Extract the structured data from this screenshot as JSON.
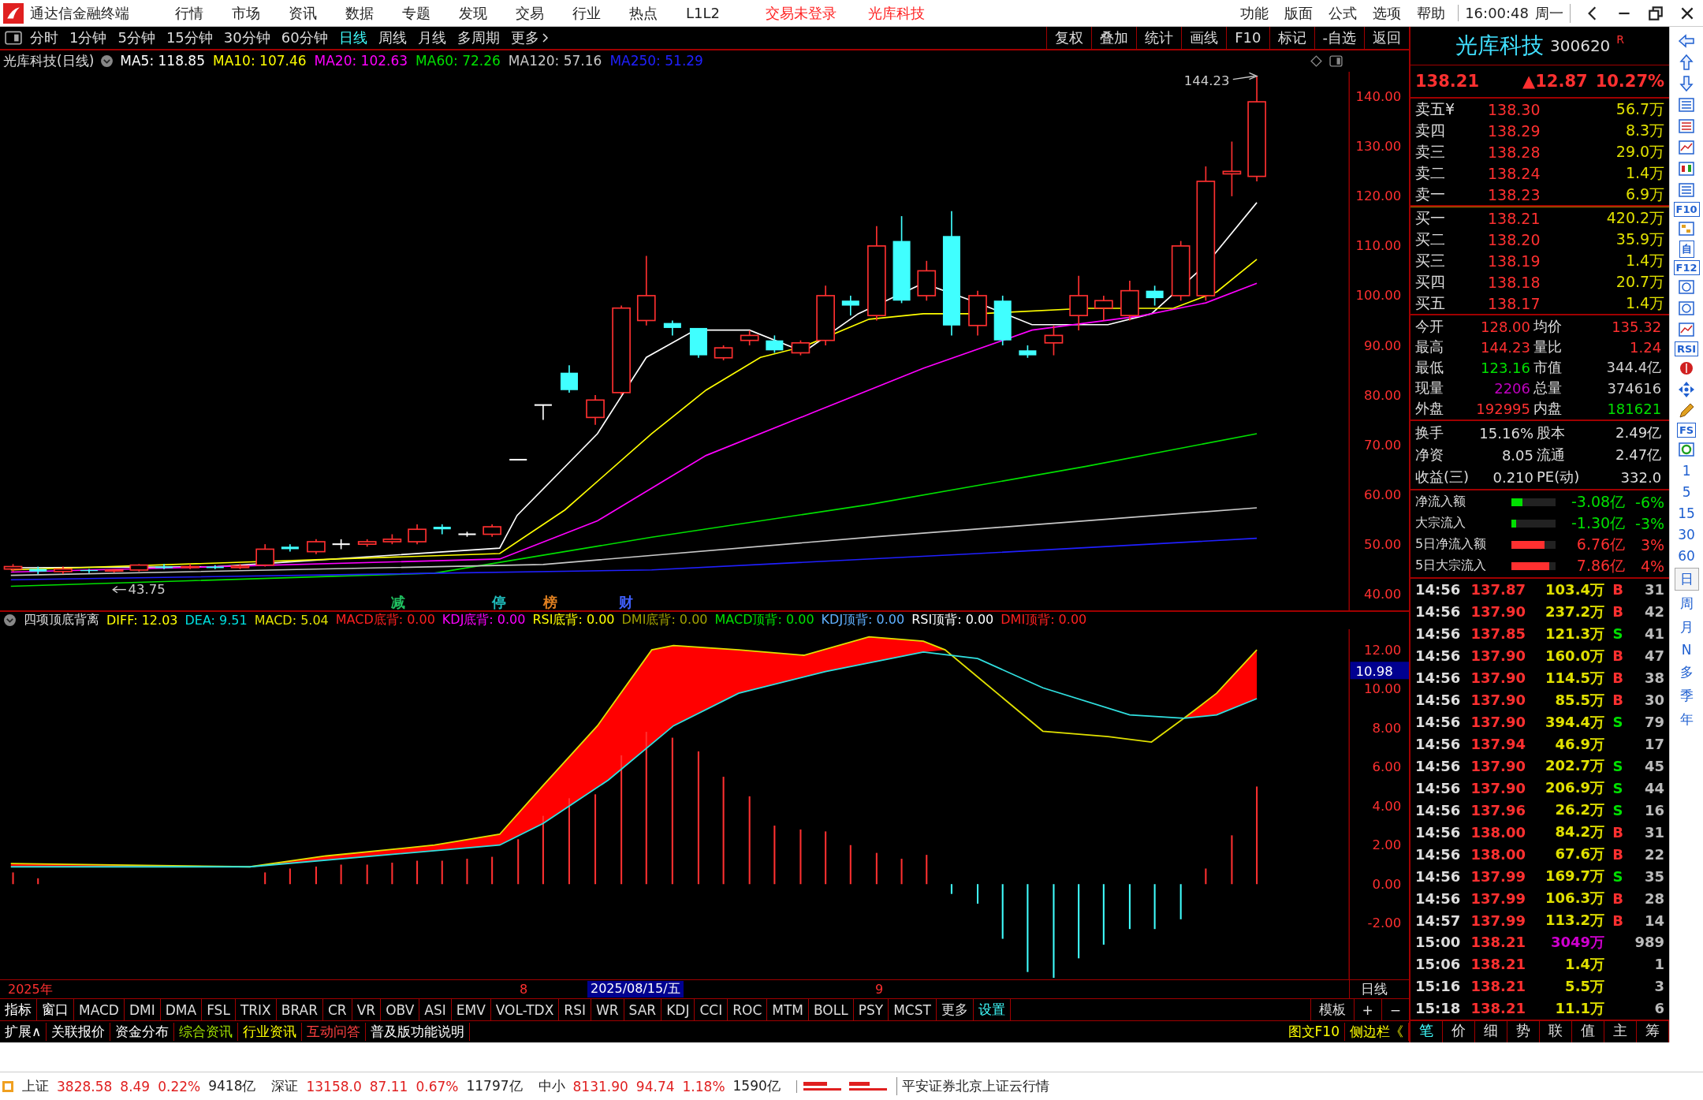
{
  "window": {
    "app_name": "通达信金融终端",
    "menu": [
      "行情",
      "市场",
      "资讯",
      "数据",
      "专题",
      "发现",
      "交易",
      "行业",
      "热点",
      "L1L2"
    ],
    "login_status": "交易未登录",
    "stock_name": "光库科技",
    "right_menu": [
      "功能",
      "版面",
      "公式",
      "选项",
      "帮助"
    ],
    "clock": "16:00:48",
    "weekday": "周一"
  },
  "period_tabs": [
    {
      "label": "分时",
      "selected": false
    },
    {
      "label": "1分钟",
      "selected": false
    },
    {
      "label": "5分钟",
      "selected": false
    },
    {
      "label": "15分钟",
      "selected": false
    },
    {
      "label": "30分钟",
      "selected": false
    },
    {
      "label": "60分钟",
      "selected": false
    },
    {
      "label": "日线",
      "selected": true
    },
    {
      "label": "周线",
      "selected": false
    },
    {
      "label": "月线",
      "selected": false
    },
    {
      "label": "多周期",
      "selected": false
    },
    {
      "label": "更多",
      "selected": false
    }
  ],
  "chart_tools": [
    "复权",
    "叠加",
    "统计",
    "画线",
    "F10",
    "标记",
    "-自选",
    "返回"
  ],
  "main_chart": {
    "title": "光库科技(日线)",
    "ma": [
      {
        "label": "MA5: 118.85",
        "color": "#ffffff"
      },
      {
        "label": "MA10: 107.46",
        "color": "#ffff00"
      },
      {
        "label": "MA20: 102.63",
        "color": "#ff00ff"
      },
      {
        "label": "MA60: 72.26",
        "color": "#00e000"
      },
      {
        "label": "MA120: 57.16",
        "color": "#c8c8c8"
      },
      {
        "label": "MA250: 51.29",
        "color": "#2020ff"
      }
    ],
    "price_labels": [
      "140.00",
      "130.00",
      "120.00",
      "110.00",
      "100.00",
      "90.00",
      "80.00",
      "70.00",
      "60.00",
      "50.00",
      "40.00"
    ],
    "high_label": "144.23",
    "low_label": "43.75",
    "events": [
      {
        "label": "减",
        "color": "#20c060"
      },
      {
        "label": "停",
        "color": "#20c0c0"
      },
      {
        "label": "榜",
        "color": "#e08020"
      },
      {
        "label": "财",
        "color": "#4060ff"
      }
    ]
  },
  "indicator": {
    "name": "四项顶底背离",
    "values": [
      {
        "label": "DIFF: 12.03",
        "color": "#ffff00"
      },
      {
        "label": "DEA: 9.51",
        "color": "#00e0e0"
      },
      {
        "label": "MACD: 5.04",
        "color": "#e0e000"
      },
      {
        "label": "MACD底背: 0.00",
        "color": "#ff2020"
      },
      {
        "label": "KDJ底背: 0.00",
        "color": "#ff00ff"
      },
      {
        "label": "RSI底背: 0.00",
        "color": "#ffff00"
      },
      {
        "label": "DMI底背: 0.00",
        "color": "#a0a000"
      },
      {
        "label": "MACD顶背: 0.00",
        "color": "#00e000"
      },
      {
        "label": "KDJ顶背: 0.00",
        "color": "#60b0ff"
      },
      {
        "label": "RSI顶背: 0.00",
        "color": "#ffffff"
      },
      {
        "label": "DMI顶背: 0.00",
        "color": "#ff2020"
      }
    ],
    "axis_labels": [
      "12.00",
      "10.00",
      "8.00",
      "6.00",
      "4.00",
      "2.00",
      "0.00",
      "-2.00"
    ],
    "current": "10.98"
  },
  "date_axis": {
    "year": "2025年",
    "month_8": "8",
    "selected_date": "2025/08/15/五",
    "month_9": "9",
    "period": "日线"
  },
  "indicator_tabs": [
    {
      "label": "指标",
      "kind": "menu"
    },
    {
      "label": "窗口",
      "kind": "menu"
    },
    {
      "label": "MACD",
      "kind": "tab"
    },
    {
      "label": "DMI",
      "kind": "tab"
    },
    {
      "label": "DMA",
      "kind": "tab"
    },
    {
      "label": "FSL",
      "kind": "tab"
    },
    {
      "label": "TRIX",
      "kind": "tab"
    },
    {
      "label": "BRAR",
      "kind": "tab"
    },
    {
      "label": "CR",
      "kind": "tab"
    },
    {
      "label": "VR",
      "kind": "tab"
    },
    {
      "label": "OBV",
      "kind": "tab"
    },
    {
      "label": "ASI",
      "kind": "tab"
    },
    {
      "label": "EMV",
      "kind": "tab"
    },
    {
      "label": "VOL-TDX",
      "kind": "tab"
    },
    {
      "label": "RSI",
      "kind": "tab"
    },
    {
      "label": "WR",
      "kind": "tab"
    },
    {
      "label": "SAR",
      "kind": "tab"
    },
    {
      "label": "KDJ",
      "kind": "tab"
    },
    {
      "label": "CCI",
      "kind": "tab"
    },
    {
      "label": "ROC",
      "kind": "tab"
    },
    {
      "label": "MTM",
      "kind": "tab"
    },
    {
      "label": "BOLL",
      "kind": "tab"
    },
    {
      "label": "PSY",
      "kind": "tab"
    },
    {
      "label": "MCST",
      "kind": "tab"
    },
    {
      "label": "更多",
      "kind": "tab"
    },
    {
      "label": "设置",
      "kind": "settings"
    }
  ],
  "indicator_tools": [
    "模板",
    "+",
    "−"
  ],
  "ext_tabs": [
    {
      "label": "扩展∧",
      "color": "#ffffff"
    },
    {
      "label": "关联报价",
      "color": "#ffffff"
    },
    {
      "label": "资金分布",
      "color": "#ffffff"
    },
    {
      "label": "综合资讯",
      "color": "#a0e000"
    },
    {
      "label": "行业资讯",
      "color": "#ffff00"
    },
    {
      "label": "互动问答",
      "color": "#ff4040"
    },
    {
      "label": "普及版功能说明",
      "color": "#ffffff"
    }
  ],
  "ext_right": [
    "图文F10",
    "侧边栏《"
  ],
  "quote": {
    "name": "光库科技",
    "code": "300620",
    "mark": "R",
    "price": "138.21",
    "change": "▲12.87",
    "pct": "10.27%"
  },
  "asks": [
    {
      "label": "卖五¥",
      "price": "138.30",
      "volume": "56.7万"
    },
    {
      "label": "卖四",
      "price": "138.29",
      "volume": "8.3万"
    },
    {
      "label": "卖三",
      "price": "138.28",
      "volume": "29.0万"
    },
    {
      "label": "卖二",
      "price": "138.24",
      "volume": "1.4万"
    },
    {
      "label": "卖一",
      "price": "138.23",
      "volume": "6.9万"
    }
  ],
  "bids": [
    {
      "label": "买一",
      "price": "138.21",
      "volume": "420.2万"
    },
    {
      "label": "买二",
      "price": "138.20",
      "volume": "35.9万"
    },
    {
      "label": "买三",
      "price": "138.19",
      "volume": "1.4万"
    },
    {
      "label": "买四",
      "price": "138.18",
      "volume": "20.7万"
    },
    {
      "label": "买五",
      "price": "138.17",
      "volume": "1.4万"
    }
  ],
  "stats": [
    {
      "label": "今开",
      "value": "128.00",
      "color": "#ff3030"
    },
    {
      "label": "均价",
      "value": "135.32",
      "color": "#ff3030"
    },
    {
      "label": "最高",
      "value": "144.23",
      "color": "#ff3030"
    },
    {
      "label": "量比",
      "value": "1.24",
      "color": "#ff3030"
    },
    {
      "label": "最低",
      "value": "123.16",
      "color": "#00e000"
    },
    {
      "label": "市值",
      "value": "344.4亿",
      "color": "#d0d0d0"
    },
    {
      "label": "现量",
      "value": "2206",
      "color": "#c000c0"
    },
    {
      "label": "总量",
      "value": "374616",
      "color": "#d0d0d0"
    },
    {
      "label": "外盘",
      "value": "192995",
      "color": "#ff3030"
    },
    {
      "label": "内盘",
      "value": "181621",
      "color": "#00e000"
    }
  ],
  "stats2": [
    {
      "label": "换手",
      "value": "15.16%"
    },
    {
      "label": "股本",
      "value": "2.49亿"
    },
    {
      "label": "净资",
      "value": "8.05"
    },
    {
      "label": "流通",
      "value": "2.47亿"
    },
    {
      "label": "收益(三)",
      "value": "0.210"
    },
    {
      "label": "PE(动)",
      "value": "332.0"
    }
  ],
  "flows": [
    {
      "label": "净流入额",
      "value": "-3.08亿",
      "pct": "-6%",
      "color": "#00e000",
      "level": 0.25
    },
    {
      "label": "大宗流入",
      "value": "-1.30亿",
      "pct": "-3%",
      "color": "#00e000",
      "level": 0.1
    },
    {
      "label": "5日净流入额",
      "value": "6.76亿",
      "pct": "3%",
      "color": "#ff3030",
      "level": 0.75
    },
    {
      "label": "5日大宗流入",
      "value": "7.86亿",
      "pct": "4%",
      "color": "#ff3030",
      "level": 0.85
    }
  ],
  "trades": [
    {
      "time": "14:56",
      "price": "137.87",
      "volume": "103.4万",
      "side": "B",
      "count": "31",
      "large": false
    },
    {
      "time": "14:56",
      "price": "137.90",
      "volume": "237.2万",
      "side": "B",
      "count": "42",
      "large": false
    },
    {
      "time": "14:56",
      "price": "137.85",
      "volume": "121.3万",
      "side": "S",
      "count": "41",
      "large": false
    },
    {
      "time": "14:56",
      "price": "137.90",
      "volume": "160.0万",
      "side": "B",
      "count": "47",
      "large": false
    },
    {
      "time": "14:56",
      "price": "137.90",
      "volume": "114.5万",
      "side": "B",
      "count": "38",
      "large": false
    },
    {
      "time": "14:56",
      "price": "137.90",
      "volume": "85.5万",
      "side": "B",
      "count": "30",
      "large": false
    },
    {
      "time": "14:56",
      "price": "137.90",
      "volume": "394.4万",
      "side": "S",
      "count": "79",
      "large": false
    },
    {
      "time": "14:56",
      "price": "137.94",
      "volume": "46.9万",
      "count": "17",
      "large": false
    },
    {
      "time": "14:56",
      "price": "137.90",
      "volume": "202.7万",
      "side": "S",
      "count": "45",
      "large": false
    },
    {
      "time": "14:56",
      "price": "137.90",
      "volume": "206.9万",
      "side": "S",
      "count": "44",
      "large": false
    },
    {
      "time": "14:56",
      "price": "137.96",
      "volume": "26.2万",
      "side": "S",
      "count": "16",
      "large": false
    },
    {
      "time": "14:56",
      "price": "138.00",
      "volume": "84.2万",
      "side": "B",
      "count": "31",
      "large": false
    },
    {
      "time": "14:56",
      "price": "138.00",
      "volume": "67.6万",
      "side": "B",
      "count": "22",
      "large": false
    },
    {
      "time": "14:56",
      "price": "137.99",
      "volume": "169.7万",
      "side": "S",
      "count": "35",
      "large": false
    },
    {
      "time": "14:56",
      "price": "137.99",
      "volume": "106.3万",
      "side": "B",
      "count": "28",
      "large": false
    },
    {
      "time": "14:57",
      "price": "137.99",
      "volume": "113.2万",
      "side": "B",
      "count": "14",
      "large": false
    },
    {
      "time": "15:00",
      "price": "138.21",
      "volume": "3049万",
      "count": "989",
      "large": true
    },
    {
      "time": "15:06",
      "price": "138.21",
      "volume": "1.4万",
      "count": "1",
      "large": false
    },
    {
      "time": "15:16",
      "price": "138.21",
      "volume": "5.5万",
      "count": "3",
      "large": false
    },
    {
      "time": "15:18",
      "price": "138.21",
      "volume": "11.1万",
      "count": "6",
      "large": false
    }
  ],
  "detail_tabs": [
    {
      "label": "笔",
      "selected": true
    },
    {
      "label": "价",
      "selected": false
    },
    {
      "label": "细",
      "selected": false
    },
    {
      "label": "势",
      "selected": false
    },
    {
      "label": "联",
      "selected": false
    },
    {
      "label": "值",
      "selected": false
    },
    {
      "label": "主",
      "selected": false
    },
    {
      "label": "筹",
      "selected": false
    }
  ],
  "sidebar": {
    "labels": [
      "F10",
      "自",
      "F12",
      "RSI",
      "FS"
    ],
    "periods": [
      {
        "label": "1",
        "selected": false
      },
      {
        "label": "5",
        "selected": false
      },
      {
        "label": "15",
        "selected": false
      },
      {
        "label": "30",
        "selected": false
      },
      {
        "label": "60",
        "selected": false
      },
      {
        "label": "日",
        "selected": true
      },
      {
        "label": "周",
        "selected": false
      },
      {
        "label": "月",
        "selected": false
      },
      {
        "label": "N",
        "selected": false
      },
      {
        "label": "多",
        "selected": false
      },
      {
        "label": "季",
        "selected": false
      },
      {
        "label": "年",
        "selected": false
      }
    ]
  },
  "status_bar": {
    "indices": [
      {
        "name": "上证",
        "value": "3828.58",
        "change": "8.49",
        "pct": "0.22%",
        "amount": "9418亿"
      },
      {
        "name": "深证",
        "value": "13158.0",
        "change": "87.11",
        "pct": "0.67%",
        "amount": "11797亿"
      },
      {
        "name": "中小",
        "value": "8131.90",
        "change": "94.74",
        "pct": "1.18%",
        "amount": "1590亿"
      }
    ],
    "broker": "平安证券北京上证云行情"
  }
}
